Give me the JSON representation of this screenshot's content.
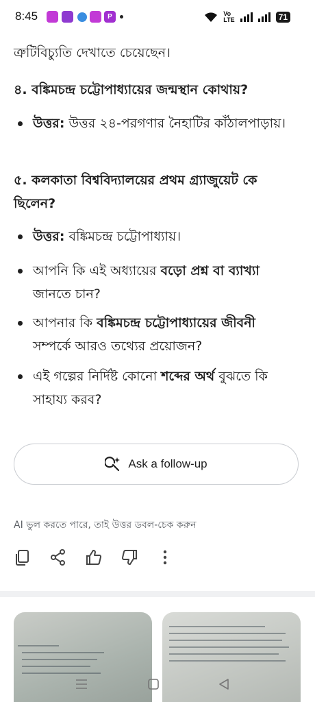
{
  "status_bar": {
    "time": "8:45",
    "notifications": [
      "app-icon",
      "app-icon",
      "app-icon",
      "app-icon",
      "p-icon"
    ],
    "notif_p": "P",
    "volte_top": "Vo",
    "volte_bottom": "LTE",
    "battery": "71"
  },
  "answer": {
    "intro_line": "ত্রুটিবিচ্যুতি দেখাতে চেয়েছেন।",
    "q4": "৪. বঙ্কিমচন্দ্র চট্টোপাধ্যায়ের জন্মস্থান কোথায়?",
    "q4_answer_label": "উত্তর:",
    "q4_answer_text": " উত্তর ২৪-পরগণার নৈহাটির কাঁঠালপাড়ায়।",
    "q5": "৫. কলকাতা বিশ্ববিদ্যালয়ের প্রথম গ্র্যাজুয়েট কে ছিলেন?",
    "q5_answer_label": "উত্তর:",
    "q5_answer_text": " বঙ্কিমচন্দ্র চট্টোপাধ্যায়।",
    "suggestion1_pre": "আপনি কি এই অধ্যায়ের ",
    "suggestion1_bold": "বড়ো প্রশ্ন বা ব্যাখ্যা",
    "suggestion1_post": " জানতে চান?",
    "suggestion2_pre": "আপনার কি ",
    "suggestion2_bold": "বঙ্কিমচন্দ্র চট্টোপাধ্যায়ের জীবনী",
    "suggestion2_post": " সম্পর্কে আরও তথ্যের প্রয়োজন?",
    "suggestion3_pre": "এই গল্পের নির্দিষ্ট কোনো ",
    "suggestion3_bold": "শব্দের অর্থ",
    "suggestion3_post": " বুঝতে কি সাহায্য করব?"
  },
  "followup": {
    "label": "Ask a follow-up"
  },
  "disclaimer": "AI ভুল করতে পারে, তাই উত্তর ডবল-চেক করুন",
  "actions": [
    "copy-icon",
    "share-icon",
    "thumbs-up-icon",
    "thumbs-down-icon",
    "more-options-icon"
  ],
  "nav": [
    "menu-icon",
    "home-icon",
    "back-icon"
  ]
}
